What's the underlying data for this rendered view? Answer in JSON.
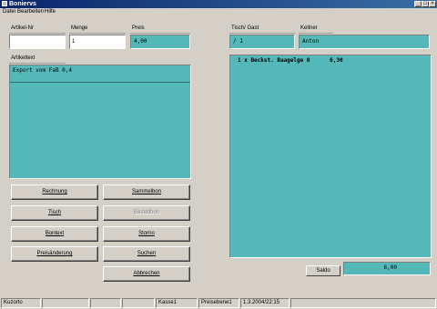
{
  "window": {
    "title": "Boniervs"
  },
  "menu": [
    "Datei",
    "Bearbeiten",
    "Hilfe"
  ],
  "fields": {
    "artikel_nr": {
      "label": "Artikel-Nr",
      "value": ""
    },
    "menge": {
      "label": "Menge",
      "value": "1"
    },
    "preis": {
      "label": "Preis",
      "value": "4,00"
    },
    "tisch_gast": {
      "label": "Tisch/ Gast",
      "value": "/ 1"
    },
    "kellner": {
      "label": "Kellner",
      "value": "Anton"
    },
    "artikeltext": {
      "label": "Artikeltext",
      "value": "Export vom Faß 0,4"
    }
  },
  "order_lines": [
    "1 x Beckst. Baagelge 0      6,30"
  ],
  "buttons": {
    "rechnung": "Rechnung",
    "sammelbon": "Sammelbon",
    "tisch": "Tisch",
    "bestellbon": "Bestellbon",
    "bontext": "Bontext",
    "storno": "Storno",
    "preisaenderung": "Preisänderung",
    "suchen": "Suchen",
    "abbrechen": "Abbrechen"
  },
  "saldo": {
    "label": "Saldo",
    "value": "6,00"
  },
  "status": [
    "Kuzorto",
    "",
    "",
    "",
    "Kasse1",
    "Preisebene1",
    "1.3.2004/22:15",
    ""
  ],
  "colors": {
    "teal": "#55b8b8",
    "face": "#d4d0c8",
    "title": "#0a246a"
  }
}
